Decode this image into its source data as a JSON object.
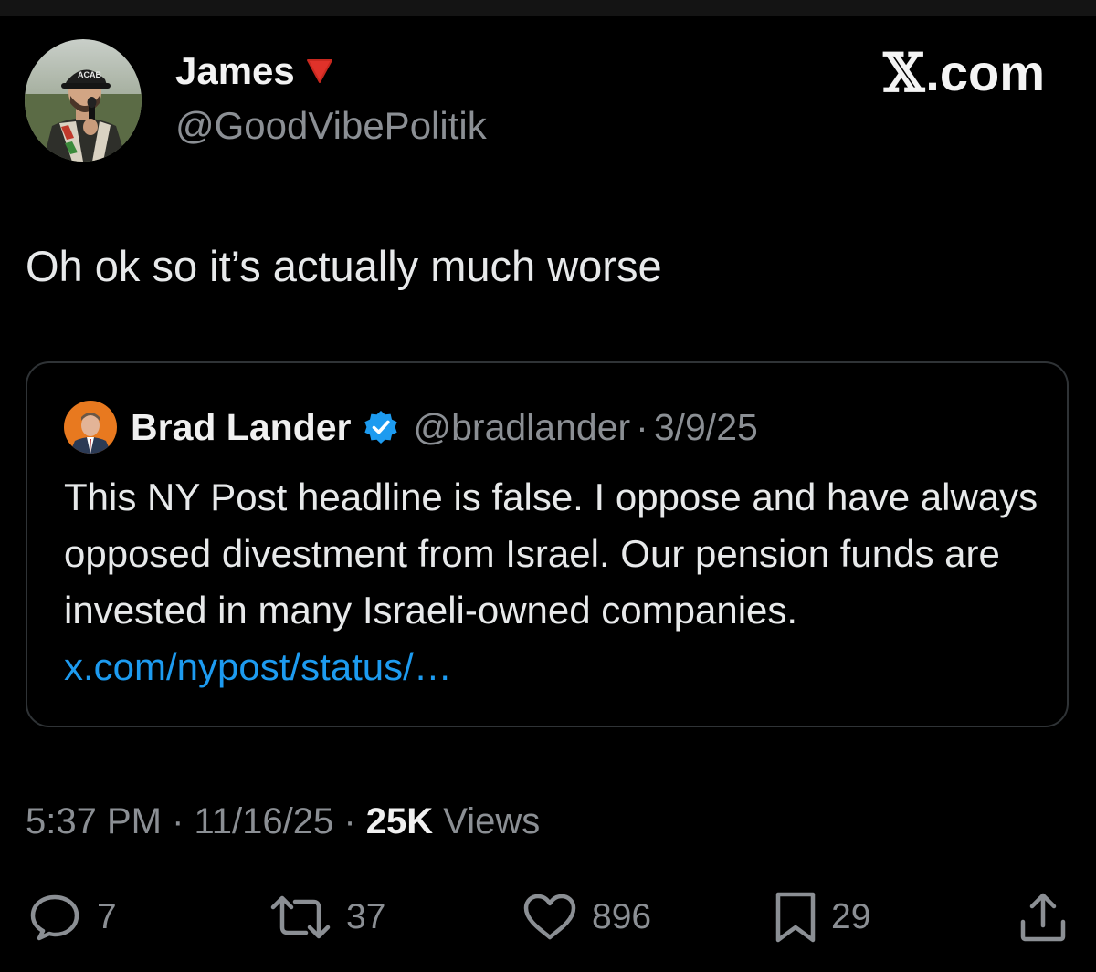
{
  "author": {
    "name": "James",
    "badge_icon": "red-triangle-down-icon",
    "handle": "@GoodVibePolitik"
  },
  "brand": {
    "x_glyph": "𝕏",
    "label": ".com"
  },
  "tweet": {
    "text": "Oh ok so it’s actually much worse"
  },
  "quote": {
    "name": "Brad Lander",
    "verified_icon": "verified-badge-icon",
    "handle": "@bradlander",
    "separator": "·",
    "date": "3/9/25",
    "body": "This NY Post headline is false. I oppose and have always opposed divestment from Israel. Our pension funds are invested in many Israeli-owned companies. ",
    "link": "x.com/nypost/status/…"
  },
  "meta": {
    "time": "5:37 PM",
    "sep1": " · ",
    "date": "11/16/25",
    "sep2": " · ",
    "views_count": "25K",
    "views_label": " Views"
  },
  "actions": {
    "replies": "7",
    "reposts": "37",
    "likes": "896",
    "bookmarks": "29"
  },
  "colors": {
    "background": "#000000",
    "text": "#e7e9ea",
    "muted": "#8b8f94",
    "link": "#1d9bf0",
    "border": "#2f3336",
    "badge_red": "#e0322a"
  }
}
